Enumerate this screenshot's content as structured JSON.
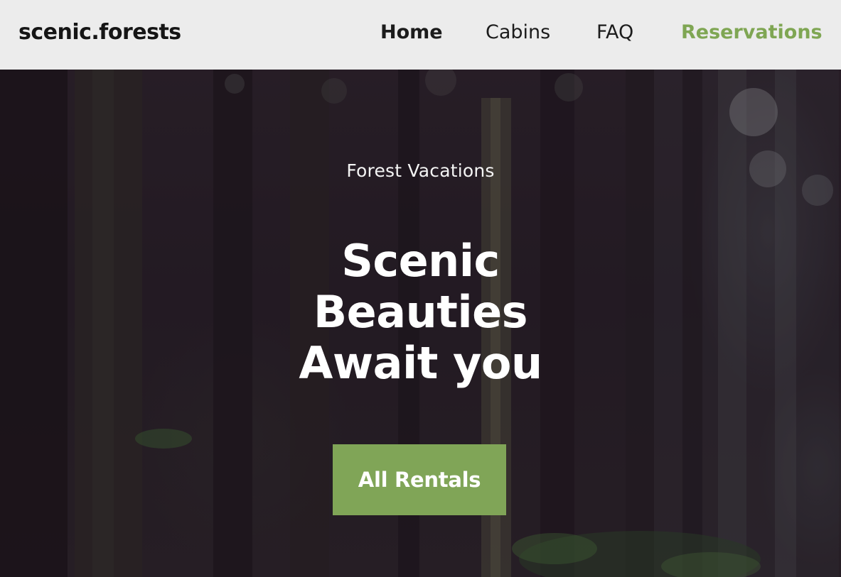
{
  "header": {
    "logo": "scenic.forests",
    "nav": {
      "home": "Home",
      "cabins": "Cabins",
      "faq": "FAQ",
      "reservations": "Reservations"
    }
  },
  "hero": {
    "eyebrow": "Forest Vacations",
    "headline_lines": [
      "Scenic",
      "Beauties",
      "Await you"
    ],
    "cta_label": "All Rentals",
    "background_image": "dark-forest-photo"
  },
  "colors": {
    "header_bg": "#ececec",
    "accent_green": "#80a557",
    "reservations_link": "#7fa653",
    "text_dark": "#151515",
    "hero_text": "#ffffff"
  }
}
